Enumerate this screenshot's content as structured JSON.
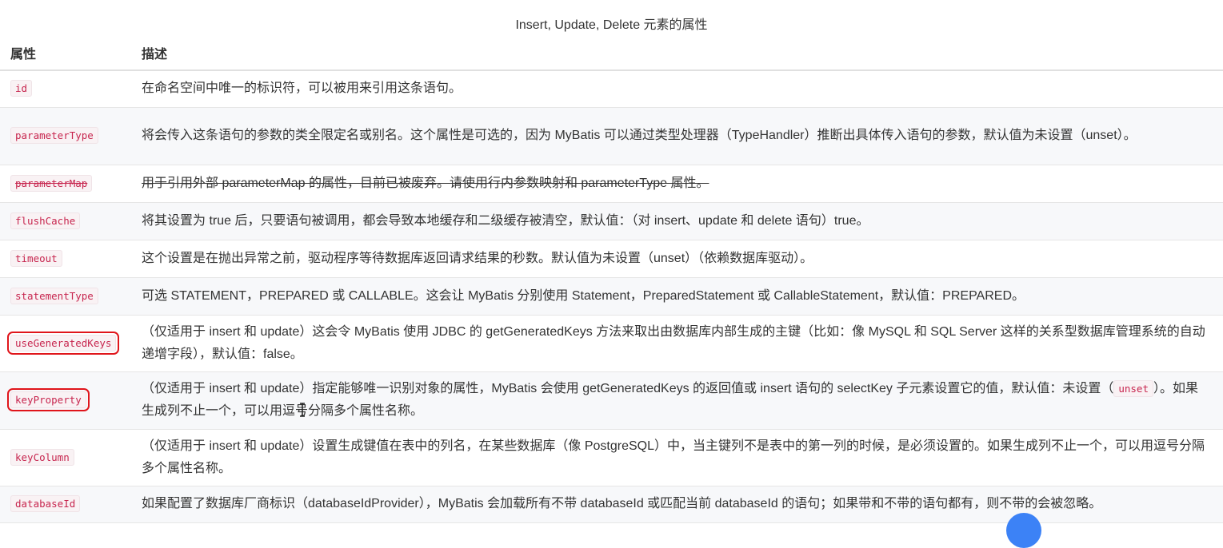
{
  "caption": "Insert, Update, Delete 元素的属性",
  "table": {
    "headers": [
      "属性",
      "描述"
    ],
    "rows": [
      {
        "attr": "id",
        "desc": "在命名空间中唯一的标识符，可以被用来引用这条语句。"
      },
      {
        "attr": "parameterType",
        "desc": "将会传入这条语句的参数的类全限定名或别名。这个属性是可选的，因为 MyBatis 可以通过类型处理器（TypeHandler）推断出具体传入语句的参数，默认值为未设置（unset）。"
      },
      {
        "attr": "parameterMap",
        "desc": "用于引用外部 parameterMap 的属性，目前已被废弃。请使用行内参数映射和 parameterType 属性。",
        "deprecated": true
      },
      {
        "attr": "flushCache",
        "desc": "将其设置为 true 后，只要语句被调用，都会导致本地缓存和二级缓存被清空，默认值：（对 insert、update 和 delete 语句）true。"
      },
      {
        "attr": "timeout",
        "desc": "这个设置是在抛出异常之前，驱动程序等待数据库返回请求结果的秒数。默认值为未设置（unset）（依赖数据库驱动）。"
      },
      {
        "attr": "statementType",
        "desc": "可选 STATEMENT，PREPARED 或 CALLABLE。这会让 MyBatis 分别使用 Statement，PreparedStatement 或 CallableStatement，默认值：PREPARED。"
      },
      {
        "attr": "useGeneratedKeys",
        "desc": "（仅适用于 insert 和 update）这会令 MyBatis 使用 JDBC 的 getGeneratedKeys 方法来取出由数据库内部生成的主键（比如：像 MySQL 和 SQL Server 这样的关系型数据库管理系统的自动递增字段），默认值：false。",
        "highlighted": true
      },
      {
        "attr": "keyProperty",
        "desc_before": "（仅适用于 insert 和 update）指定能够唯一识别对象的属性，MyBatis 会使用 getGeneratedKeys 的返回值或 insert 语句的 selectKey 子元素设置它的值，默认值：未设置（",
        "desc_code": "unset",
        "desc_after": "）。如果生成列不止一个，可以用逗号分隔多个属性名称。",
        "highlighted": true
      },
      {
        "attr": "keyColumn",
        "desc": "（仅适用于 insert 和 update）设置生成键值在表中的列名，在某些数据库（像 PostgreSQL）中，当主键列不是表中的第一列的时候，是必须设置的。如果生成列不止一个，可以用逗号分隔多个属性名称。"
      },
      {
        "attr": "databaseId",
        "desc": "如果配置了数据库厂商标识（databaseIdProvider），MyBatis 会加载所有不带 databaseId 或匹配当前 databaseId 的语句；如果带和不带的语句都有，则不带的会被忽略。"
      }
    ]
  },
  "colors": {
    "highlight_box": "#e0151b",
    "code_text": "#c7254e",
    "code_bg": "#f9f2f4"
  }
}
